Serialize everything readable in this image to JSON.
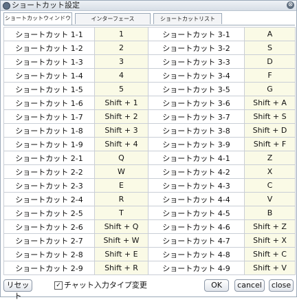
{
  "window": {
    "title": "ショートカット設定",
    "close_glyph": "⊗"
  },
  "tabs": [
    {
      "label": "ショートカットウィンドウ",
      "active": true
    },
    {
      "label": "インターフェース",
      "active": false
    },
    {
      "label": "ショートカットリスト",
      "active": false
    }
  ],
  "rows": [
    {
      "left_name": "ショートカット 1-1",
      "left_key": "1",
      "right_name": "ショートカット 3-1",
      "right_key": "A"
    },
    {
      "left_name": "ショートカット 1-2",
      "left_key": "2",
      "right_name": "ショートカット 3-2",
      "right_key": "S"
    },
    {
      "left_name": "ショートカット 1-3",
      "left_key": "3",
      "right_name": "ショートカット 3-3",
      "right_key": "D"
    },
    {
      "left_name": "ショートカット 1-4",
      "left_key": "4",
      "right_name": "ショートカット 3-4",
      "right_key": "F"
    },
    {
      "left_name": "ショートカット 1-5",
      "left_key": "5",
      "right_name": "ショートカット 3-5",
      "right_key": "G"
    },
    {
      "left_name": "ショートカット 1-6",
      "left_key": "Shift + 1",
      "right_name": "ショートカット 3-6",
      "right_key": "Shift + A"
    },
    {
      "left_name": "ショートカット 1-7",
      "left_key": "Shift + 2",
      "right_name": "ショートカット 3-7",
      "right_key": "Shift + S"
    },
    {
      "left_name": "ショートカット 1-8",
      "left_key": "Shift + 3",
      "right_name": "ショートカット 3-8",
      "right_key": "Shift + D"
    },
    {
      "left_name": "ショートカット 1-9",
      "left_key": "Shift + 4",
      "right_name": "ショートカット 3-9",
      "right_key": "Shift + F"
    },
    {
      "left_name": "ショートカット 2-1",
      "left_key": "Q",
      "right_name": "ショートカット 4-1",
      "right_key": "Z"
    },
    {
      "left_name": "ショートカット 2-2",
      "left_key": "W",
      "right_name": "ショートカット 4-2",
      "right_key": "X"
    },
    {
      "left_name": "ショートカット 2-3",
      "left_key": "E",
      "right_name": "ショートカット 4-3",
      "right_key": "C"
    },
    {
      "left_name": "ショートカット 2-4",
      "left_key": "R",
      "right_name": "ショートカット 4-4",
      "right_key": "V"
    },
    {
      "left_name": "ショートカット 2-5",
      "left_key": "T",
      "right_name": "ショートカット 4-5",
      "right_key": "B"
    },
    {
      "left_name": "ショートカット 2-6",
      "left_key": "Shift + Q",
      "right_name": "ショートカット 4-6",
      "right_key": "Shift + Z"
    },
    {
      "left_name": "ショートカット 2-7",
      "left_key": "Shift + W",
      "right_name": "ショートカット 4-7",
      "right_key": "Shift + X"
    },
    {
      "left_name": "ショートカット 2-8",
      "left_key": "Shift + E",
      "right_name": "ショートカット 4-8",
      "right_key": "Shift + C"
    },
    {
      "left_name": "ショートカット 2-9",
      "left_key": "Shift + R",
      "right_name": "ショートカット 4-9",
      "right_key": "Shift + V"
    }
  ],
  "footer": {
    "reset_label": "リセット",
    "checkbox_label": "チャット入力タイプ変更",
    "checkbox_checked": true,
    "ok_label": "OK",
    "cancel_label": "cancel",
    "close_label": "close"
  },
  "colors": {
    "key_cell_bg": "#fafae6",
    "grid_line": "#c9ced6",
    "border": "#9aa8b8"
  }
}
